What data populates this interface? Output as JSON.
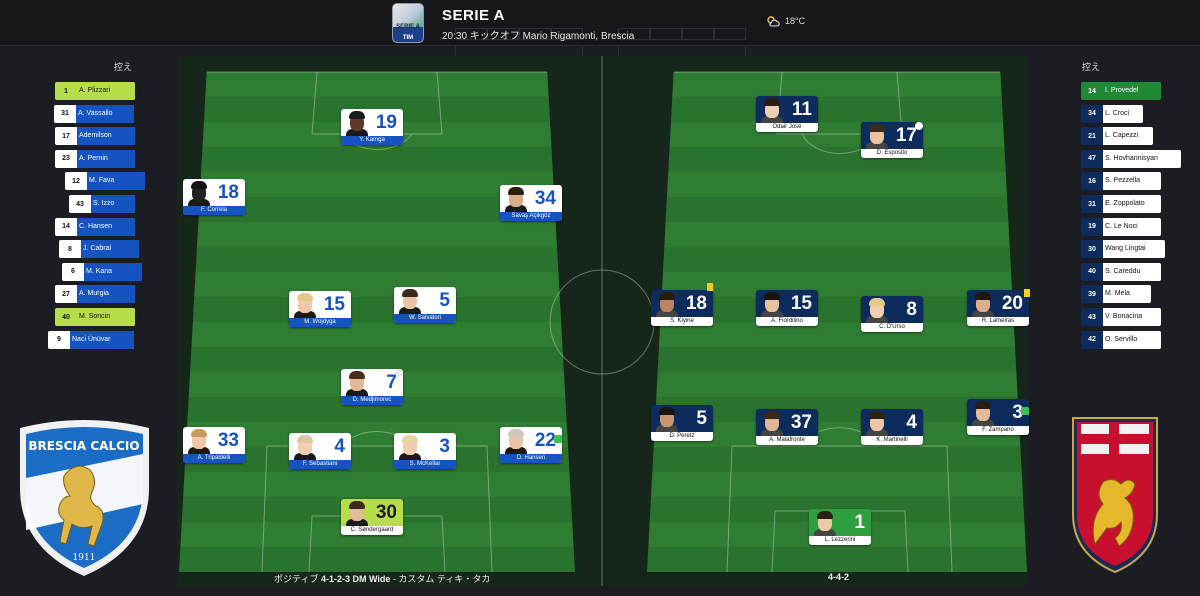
{
  "header": {
    "competition": "SERIE A",
    "match_info": "20:30 キックオフ Mario Rigamonti, Brescia",
    "temperature": "18°C",
    "weather_icon": "partly-cloudy-icon",
    "league_logo_text": "SERIE A",
    "league_logo_sponsor": "TIM"
  },
  "home": {
    "crest_text": "BRESCIA CALCIO",
    "crest_year": "1911",
    "formation_prefix": "ポジティブ",
    "formation": "4-1-2-3 DM Wide",
    "formation_suffix": "- カスタム ティキ・タカ",
    "subs_title": "控え",
    "subs": [
      {
        "num": "1",
        "name": "A. Plizzari",
        "highlight": true
      },
      {
        "num": "31",
        "name": "A. Vassallo"
      },
      {
        "num": "17",
        "name": "Ademilson"
      },
      {
        "num": "23",
        "name": "A. Pernin"
      },
      {
        "num": "12",
        "name": "M. Fava"
      },
      {
        "num": "43",
        "name": "S. Izzo"
      },
      {
        "num": "14",
        "name": "C. Hansen"
      },
      {
        "num": "8",
        "name": "J. Cabral"
      },
      {
        "num": "6",
        "name": "M. Kana"
      },
      {
        "num": "27",
        "name": "A. Murgia"
      },
      {
        "num": "40",
        "name": "M. Soncin",
        "highlight": true
      },
      {
        "num": "9",
        "name": "Naci Ünüvar"
      }
    ],
    "players": [
      {
        "num": "19",
        "name": "Y. Kamga"
      },
      {
        "num": "18",
        "name": "F. Correia"
      },
      {
        "num": "34",
        "name": "Savaş Açikgöz"
      },
      {
        "num": "15",
        "name": "M. Wojdyga"
      },
      {
        "num": "5",
        "name": "W. Salvatori"
      },
      {
        "num": "7",
        "name": "D. Medjimorec"
      },
      {
        "num": "33",
        "name": "A. Tripaldelli"
      },
      {
        "num": "4",
        "name": "F. Sebastiani"
      },
      {
        "num": "3",
        "name": "S. McKellar"
      },
      {
        "num": "22",
        "name": "D. Hansen"
      },
      {
        "num": "30",
        "name": "C. Søndergaard"
      }
    ]
  },
  "away": {
    "formation": "4-4-2",
    "subs_title": "控え",
    "subs": [
      {
        "num": "14",
        "name": "I. Provedel",
        "highlight": true
      },
      {
        "num": "34",
        "name": "L. Croci"
      },
      {
        "num": "21",
        "name": "L. Capezzi"
      },
      {
        "num": "47",
        "name": "S. Hovhannisyan"
      },
      {
        "num": "16",
        "name": "S. Pezzella"
      },
      {
        "num": "31",
        "name": "E. Zoppolato"
      },
      {
        "num": "19",
        "name": "C. Le Noci"
      },
      {
        "num": "30",
        "name": "Wang Lingtai"
      },
      {
        "num": "40",
        "name": "S. Careddu"
      },
      {
        "num": "39",
        "name": "M. Mela"
      },
      {
        "num": "43",
        "name": "V. Bonacina"
      },
      {
        "num": "42",
        "name": "O. Servillo"
      }
    ],
    "players": [
      {
        "num": "11",
        "name": "Odair José"
      },
      {
        "num": "17",
        "name": "D. Esposito"
      },
      {
        "num": "18",
        "name": "S. Kiyine"
      },
      {
        "num": "15",
        "name": "A. Fiordilino"
      },
      {
        "num": "8",
        "name": "C. D'Urso"
      },
      {
        "num": "20",
        "name": "R. Lameiras"
      },
      {
        "num": "5",
        "name": "D. Peretz"
      },
      {
        "num": "37",
        "name": "A. Malafronte"
      },
      {
        "num": "4",
        "name": "K. Martinelli"
      },
      {
        "num": "3",
        "name": "F. Zampano"
      },
      {
        "num": "1",
        "name": "L. Lezzerini"
      }
    ]
  },
  "colors": {
    "home_blue": "#1553c0",
    "away_navy": "#0d2b5c",
    "home_gk": "#b7de4a",
    "away_gk": "#2e9e3e",
    "pitch": "#2e7d32"
  }
}
